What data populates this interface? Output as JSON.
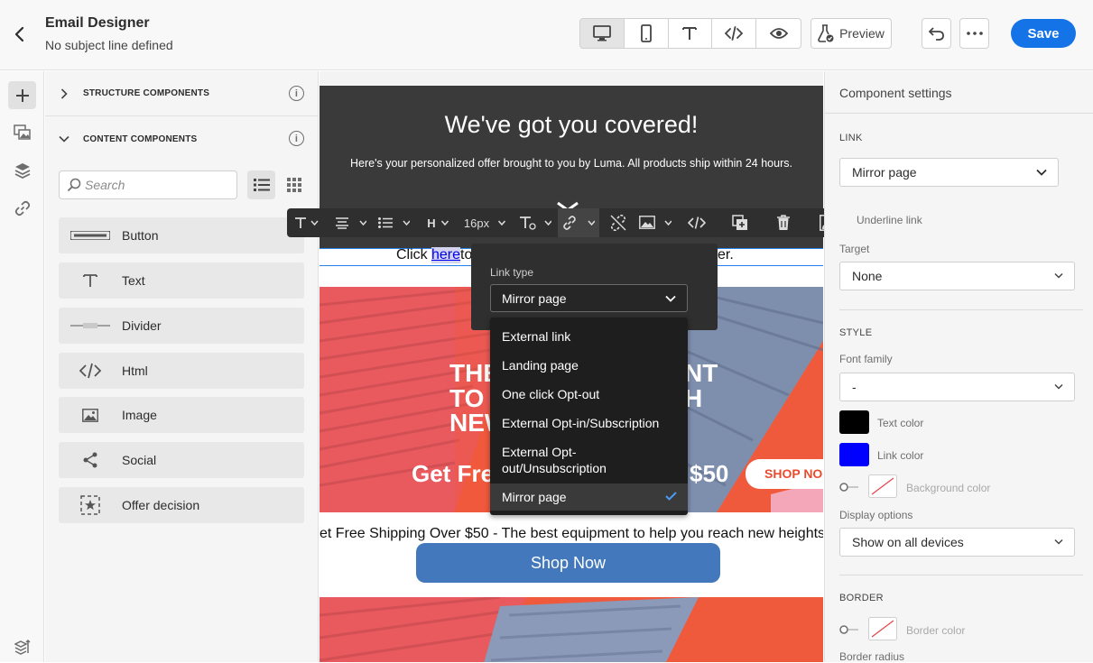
{
  "header": {
    "title": "Email Designer",
    "subtitle": "No subject line defined",
    "preview_label": "Preview",
    "save_label": "Save"
  },
  "left_panel": {
    "structure_heading": "STRUCTURE COMPONENTS",
    "content_heading": "CONTENT COMPONENTS",
    "search_placeholder": "Search",
    "components": [
      {
        "label": "Button",
        "icon": "button-icon"
      },
      {
        "label": "Text",
        "icon": "text-icon"
      },
      {
        "label": "Divider",
        "icon": "divider-icon"
      },
      {
        "label": "Html",
        "icon": "html-icon"
      },
      {
        "label": "Image",
        "icon": "image-icon"
      },
      {
        "label": "Social",
        "icon": "share-icon"
      },
      {
        "label": "Offer decision",
        "icon": "offer-decision-icon"
      }
    ]
  },
  "canvas": {
    "hero_title": "We've got you covered!",
    "hero_subtitle": "Here's your personalized offer brought to you by Luma. All products ship within 24 hours.",
    "click_prefix": "Click ",
    "click_link": "here",
    "click_mid": " to",
    "click_suffix": "ser.",
    "banner_line1": "THE",
    "banner_line2": "TO",
    "banner_line3": "NEW",
    "banner_right1": "NT",
    "banner_right2": "H",
    "banner_get_free": "Get Fre",
    "banner_price": "$50",
    "banner_shop": "SHOP NO",
    "shipping_text": "et Free Shipping Over $50 - The best equipment to help you reach new heights",
    "shop_now": "Shop Now"
  },
  "toolbar": {
    "heading_label": "H",
    "font_size": "16px"
  },
  "link_popover": {
    "label": "Link type",
    "selected": "Mirror page",
    "options": [
      "External link",
      "Landing page",
      "One click Opt-out",
      "External Opt-in/Subscription",
      "External Opt-out/Unsubscription",
      "Mirror page"
    ]
  },
  "right_panel": {
    "title": "Component settings",
    "link_section": "LINK",
    "link_value": "Mirror page",
    "underline_label": "Underline link",
    "target_label": "Target",
    "target_value": "None",
    "style_section": "STYLE",
    "font_family_label": "Font family",
    "font_family_value": "-",
    "text_color_label": "Text color",
    "link_color_label": "Link color",
    "background_color_label": "Background color",
    "display_options_label": "Display options",
    "display_options_value": "Show on all devices",
    "border_section": "BORDER",
    "border_color_label": "Border color",
    "border_radius_label": "Border radius",
    "colors": {
      "text": "#000000",
      "link": "#0000ff"
    }
  },
  "colors": {
    "accent": "#1473e6",
    "hero_bg": "#3a3a3a",
    "button_bg": "#4378bd",
    "banner": "#f05a3c"
  }
}
